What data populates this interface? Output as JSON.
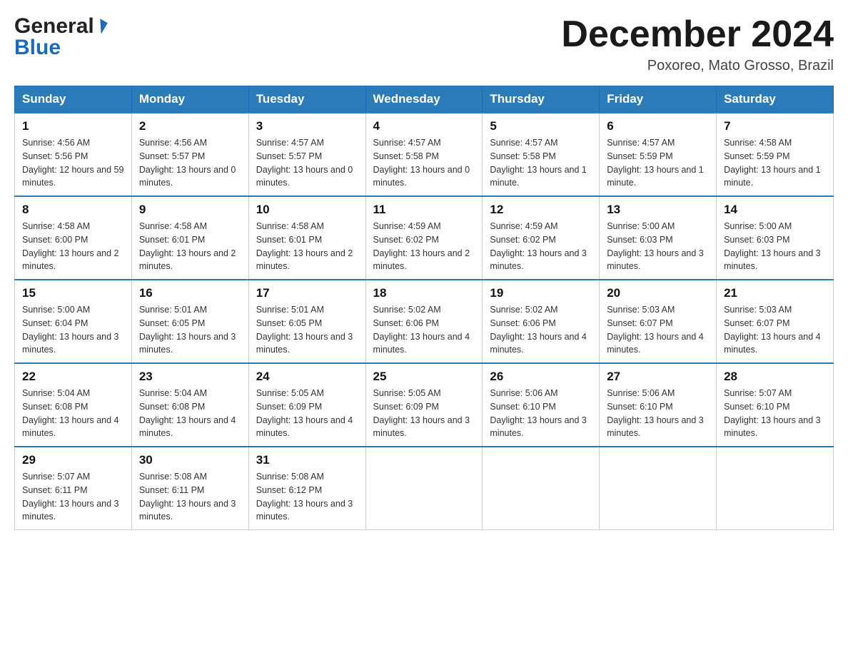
{
  "header": {
    "logo_line1": "General",
    "logo_line2": "Blue",
    "month_title": "December 2024",
    "location": "Poxoreo, Mato Grosso, Brazil"
  },
  "weekdays": [
    "Sunday",
    "Monday",
    "Tuesday",
    "Wednesday",
    "Thursday",
    "Friday",
    "Saturday"
  ],
  "weeks": [
    [
      {
        "day": "1",
        "sunrise": "4:56 AM",
        "sunset": "5:56 PM",
        "daylight": "12 hours and 59 minutes."
      },
      {
        "day": "2",
        "sunrise": "4:56 AM",
        "sunset": "5:57 PM",
        "daylight": "13 hours and 0 minutes."
      },
      {
        "day": "3",
        "sunrise": "4:57 AM",
        "sunset": "5:57 PM",
        "daylight": "13 hours and 0 minutes."
      },
      {
        "day": "4",
        "sunrise": "4:57 AM",
        "sunset": "5:58 PM",
        "daylight": "13 hours and 0 minutes."
      },
      {
        "day": "5",
        "sunrise": "4:57 AM",
        "sunset": "5:58 PM",
        "daylight": "13 hours and 1 minute."
      },
      {
        "day": "6",
        "sunrise": "4:57 AM",
        "sunset": "5:59 PM",
        "daylight": "13 hours and 1 minute."
      },
      {
        "day": "7",
        "sunrise": "4:58 AM",
        "sunset": "5:59 PM",
        "daylight": "13 hours and 1 minute."
      }
    ],
    [
      {
        "day": "8",
        "sunrise": "4:58 AM",
        "sunset": "6:00 PM",
        "daylight": "13 hours and 2 minutes."
      },
      {
        "day": "9",
        "sunrise": "4:58 AM",
        "sunset": "6:01 PM",
        "daylight": "13 hours and 2 minutes."
      },
      {
        "day": "10",
        "sunrise": "4:58 AM",
        "sunset": "6:01 PM",
        "daylight": "13 hours and 2 minutes."
      },
      {
        "day": "11",
        "sunrise": "4:59 AM",
        "sunset": "6:02 PM",
        "daylight": "13 hours and 2 minutes."
      },
      {
        "day": "12",
        "sunrise": "4:59 AM",
        "sunset": "6:02 PM",
        "daylight": "13 hours and 3 minutes."
      },
      {
        "day": "13",
        "sunrise": "5:00 AM",
        "sunset": "6:03 PM",
        "daylight": "13 hours and 3 minutes."
      },
      {
        "day": "14",
        "sunrise": "5:00 AM",
        "sunset": "6:03 PM",
        "daylight": "13 hours and 3 minutes."
      }
    ],
    [
      {
        "day": "15",
        "sunrise": "5:00 AM",
        "sunset": "6:04 PM",
        "daylight": "13 hours and 3 minutes."
      },
      {
        "day": "16",
        "sunrise": "5:01 AM",
        "sunset": "6:05 PM",
        "daylight": "13 hours and 3 minutes."
      },
      {
        "day": "17",
        "sunrise": "5:01 AM",
        "sunset": "6:05 PM",
        "daylight": "13 hours and 3 minutes."
      },
      {
        "day": "18",
        "sunrise": "5:02 AM",
        "sunset": "6:06 PM",
        "daylight": "13 hours and 4 minutes."
      },
      {
        "day": "19",
        "sunrise": "5:02 AM",
        "sunset": "6:06 PM",
        "daylight": "13 hours and 4 minutes."
      },
      {
        "day": "20",
        "sunrise": "5:03 AM",
        "sunset": "6:07 PM",
        "daylight": "13 hours and 4 minutes."
      },
      {
        "day": "21",
        "sunrise": "5:03 AM",
        "sunset": "6:07 PM",
        "daylight": "13 hours and 4 minutes."
      }
    ],
    [
      {
        "day": "22",
        "sunrise": "5:04 AM",
        "sunset": "6:08 PM",
        "daylight": "13 hours and 4 minutes."
      },
      {
        "day": "23",
        "sunrise": "5:04 AM",
        "sunset": "6:08 PM",
        "daylight": "13 hours and 4 minutes."
      },
      {
        "day": "24",
        "sunrise": "5:05 AM",
        "sunset": "6:09 PM",
        "daylight": "13 hours and 4 minutes."
      },
      {
        "day": "25",
        "sunrise": "5:05 AM",
        "sunset": "6:09 PM",
        "daylight": "13 hours and 3 minutes."
      },
      {
        "day": "26",
        "sunrise": "5:06 AM",
        "sunset": "6:10 PM",
        "daylight": "13 hours and 3 minutes."
      },
      {
        "day": "27",
        "sunrise": "5:06 AM",
        "sunset": "6:10 PM",
        "daylight": "13 hours and 3 minutes."
      },
      {
        "day": "28",
        "sunrise": "5:07 AM",
        "sunset": "6:10 PM",
        "daylight": "13 hours and 3 minutes."
      }
    ],
    [
      {
        "day": "29",
        "sunrise": "5:07 AM",
        "sunset": "6:11 PM",
        "daylight": "13 hours and 3 minutes."
      },
      {
        "day": "30",
        "sunrise": "5:08 AM",
        "sunset": "6:11 PM",
        "daylight": "13 hours and 3 minutes."
      },
      {
        "day": "31",
        "sunrise": "5:08 AM",
        "sunset": "6:12 PM",
        "daylight": "13 hours and 3 minutes."
      },
      null,
      null,
      null,
      null
    ]
  ]
}
